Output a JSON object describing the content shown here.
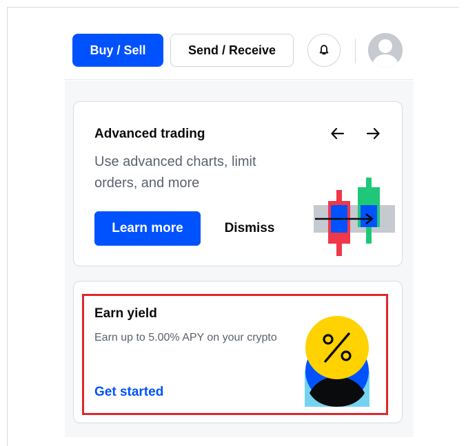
{
  "header": {
    "buy_sell_label": "Buy / Sell",
    "send_receive_label": "Send / Receive"
  },
  "advanced_trading": {
    "title": "Advanced trading",
    "description": "Use advanced charts, limit orders, and more",
    "learn_more_label": "Learn more",
    "dismiss_label": "Dismiss"
  },
  "earn_yield": {
    "title": "Earn yield",
    "description": "Earn up to 5.00% APY on your crypto",
    "cta_label": "Get started"
  },
  "icons": {
    "notifications": "bell-icon",
    "avatar": "user-avatar-icon",
    "previous": "arrow-left-icon",
    "next": "arrow-right-icon",
    "trading_illustration": "candlestick-chart-illustration",
    "earn_illustration": "percent-illustration"
  },
  "colors": {
    "accent": "#0052ff",
    "highlight_border": "#e0262a",
    "candle_red": "#f0384a",
    "candle_green": "#1fc879",
    "percent_yellow": "#ffd200"
  }
}
